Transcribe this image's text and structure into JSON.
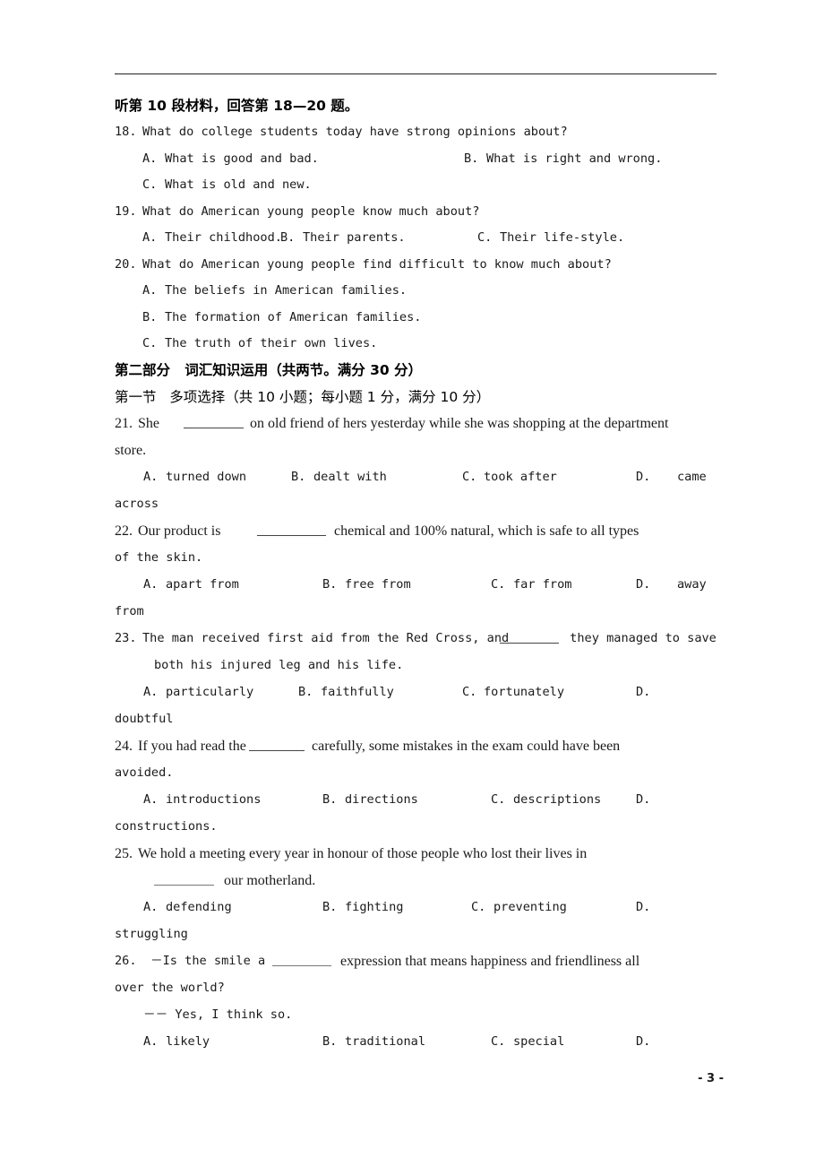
{
  "document": {
    "page_number_label": "- 3 -"
  },
  "listening": {
    "section_heading": "听第 10 段材料，回答第 18—20 题。",
    "questions": [
      {
        "number": "18.",
        "stem": "What do college students today have strong opinions about?",
        "options_row1": [
          {
            "label": "A.",
            "text": "What is good and bad."
          },
          {
            "label": "B.",
            "text": "What is right and wrong."
          }
        ],
        "options_row2": [
          {
            "label": "C.",
            "text": "What is old and new."
          }
        ]
      },
      {
        "number": "19.",
        "stem": "What do American young people know much about?",
        "options_row1": [
          {
            "label": "A.",
            "text": "Their childhood."
          },
          {
            "label": "B.",
            "text": "Their parents."
          },
          {
            "label": "C.",
            "text": "Their life-style."
          }
        ]
      },
      {
        "number": "20.",
        "stem": "What do American young people find difficult to know much about?",
        "stacked_options": [
          {
            "label": "A.",
            "text": "The beliefs in American families."
          },
          {
            "label": "B.",
            "text": "The formation of American families."
          },
          {
            "label": "C.",
            "text": "The truth of their own lives."
          }
        ]
      }
    ]
  },
  "part_two": {
    "heading": "第二部分   词汇知识运用（共两节。满分 30 分）",
    "subsection_heading": "第一节   多项选择（共 10 小题；每小题 1 分，满分 10 分）",
    "questions": [
      {
        "number": "21.",
        "stem_before_blank": "She ",
        "stem_after_blank": " on old friend of hers yesterday while she was shopping at the department",
        "stem_wrap": "store.",
        "options": [
          {
            "label": "A.",
            "text": "turned down"
          },
          {
            "label": "B.",
            "text": "dealt with"
          },
          {
            "label": "C.",
            "text": "took after"
          },
          {
            "label": "D.",
            "text": "came"
          }
        ],
        "options_wrap": "across"
      },
      {
        "number": "22.",
        "stem_before_blank": "Our product is ",
        "stem_after_blank": " chemical and 100% natural, which is safe to all types",
        "stem_wrap": "of the skin.",
        "options": [
          {
            "label": "A.",
            "text": "apart from"
          },
          {
            "label": "B.",
            "text": "free from"
          },
          {
            "label": "C.",
            "text": "far from"
          },
          {
            "label": "D.",
            "text": "away"
          }
        ],
        "options_wrap": "from"
      },
      {
        "number": "23.",
        "stem_before_blank": "The man received first aid from the Red Cross, and ",
        "stem_after_blank": " they managed to save",
        "stem_wrap": "both his injured leg and his life.",
        "options": [
          {
            "label": "A.",
            "text": "particularly"
          },
          {
            "label": "B.",
            "text": "faithfully"
          },
          {
            "label": "C.",
            "text": "fortunately"
          },
          {
            "label": "D.",
            "text": ""
          }
        ],
        "options_wrap": "doubtful"
      },
      {
        "number": "24.",
        "stem_before_blank": "If you had read the ",
        "stem_after_blank": " carefully, some mistakes in the exam could have been",
        "stem_wrap": "avoided.",
        "options": [
          {
            "label": "A.",
            "text": "introductions"
          },
          {
            "label": "B.",
            "text": "directions"
          },
          {
            "label": "C.",
            "text": "descriptions"
          },
          {
            "label": "D.",
            "text": ""
          }
        ],
        "options_wrap": "constructions."
      },
      {
        "number": "25.",
        "stem_before_blank": "We hold a meeting every year in honour of those people who lost their lives in",
        "stem_after_blank": " our motherland.",
        "options": [
          {
            "label": "A.",
            "text": "defending"
          },
          {
            "label": "B.",
            "text": "fighting"
          },
          {
            "label": "C.",
            "text": "preventing"
          },
          {
            "label": "D.",
            "text": ""
          }
        ],
        "options_wrap": "struggling"
      },
      {
        "number": "26.",
        "stem_before_blank": "－Is the smile a ",
        "stem_after_blank": " expression that means happiness and friendliness all",
        "stem_wrap": "over the world?",
        "reply": "－－ Yes, I think so.",
        "options": [
          {
            "label": "A.",
            "text": "likely"
          },
          {
            "label": "B.",
            "text": "traditional"
          },
          {
            "label": "C.",
            "text": "special"
          },
          {
            "label": "D.",
            "text": ""
          }
        ]
      }
    ]
  }
}
